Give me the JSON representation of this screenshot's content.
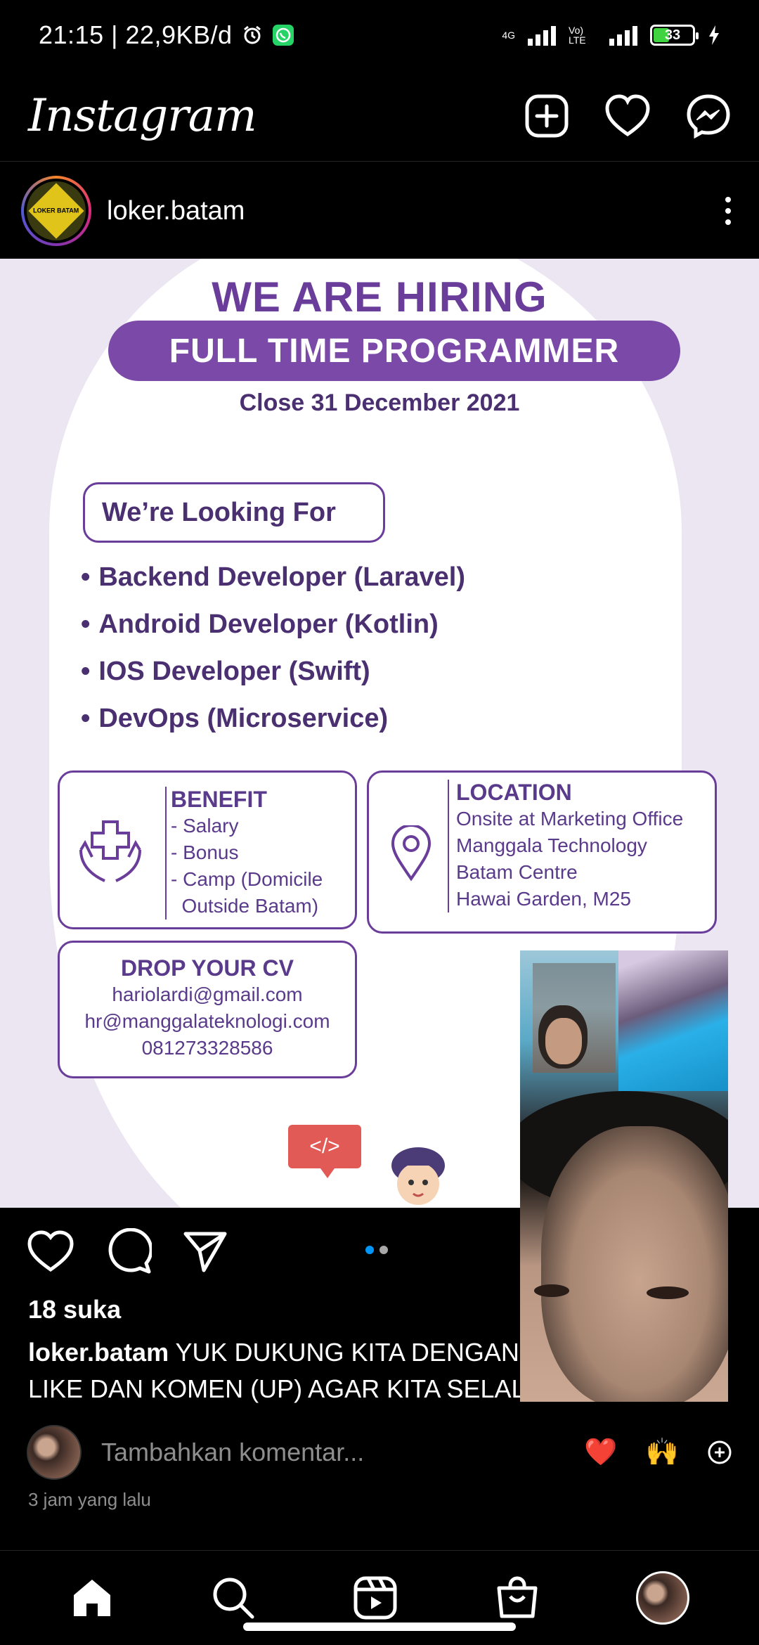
{
  "status_bar": {
    "time": "21:15 | 22,9KB/d",
    "network1": "4G",
    "network2": "Vo) LTE",
    "battery": "33"
  },
  "header": {
    "logo": "Instagram"
  },
  "post": {
    "username": "loker.batam",
    "avatar_text": "LOKER BATAM",
    "image": {
      "headline": "WE ARE HIRING",
      "banner": "FULL TIME PROGRAMMER",
      "close_date": "Close 31 December 2021",
      "looking_for": "We’re Looking For",
      "roles": [
        "Backend Developer (Laravel)",
        "Android Developer (Kotlin)",
        "IOS Developer (Swift)",
        "DevOps (Microservice)"
      ],
      "benefit": {
        "title": "BENEFIT",
        "lines": [
          "- Salary",
          "- Bonus",
          "- Camp (Domicile",
          "  Outside Batam)"
        ]
      },
      "location": {
        "title": "LOCATION",
        "lines": [
          "Onsite at Marketing Office",
          "Manggala Technology",
          "Batam Centre",
          "Hawai Garden, M25"
        ]
      },
      "drop_cv": {
        "title": "DROP YOUR CV",
        "lines": [
          "hariolardi@gmail.com",
          "hr@manggalateknologi.com",
          "081273328586"
        ]
      },
      "code_badge": "</>"
    },
    "carousel": {
      "count": 2,
      "active": 0
    },
    "likes": "18 suka",
    "caption_user": "loker.batam",
    "caption_line1": "YUK DUKUNG KITA DENGAN",
    "caption_line2": "LIKE DAN KOMEN (UP) AGAR KITA SELAL",
    "comment_placeholder": "Tambahkan komentar...",
    "quick_emojis": [
      "❤️",
      "🙌"
    ],
    "time_ago": "3 jam yang lalu"
  },
  "colors": {
    "accent_purple": "#7b4aa8",
    "like_red": "#ed4956",
    "dot_active": "#0095f6",
    "dot_inactive": "#a8a8a8"
  },
  "nav": {
    "items": [
      "home-icon",
      "search-icon",
      "reels-icon",
      "shop-icon",
      "profile-avatar"
    ]
  }
}
